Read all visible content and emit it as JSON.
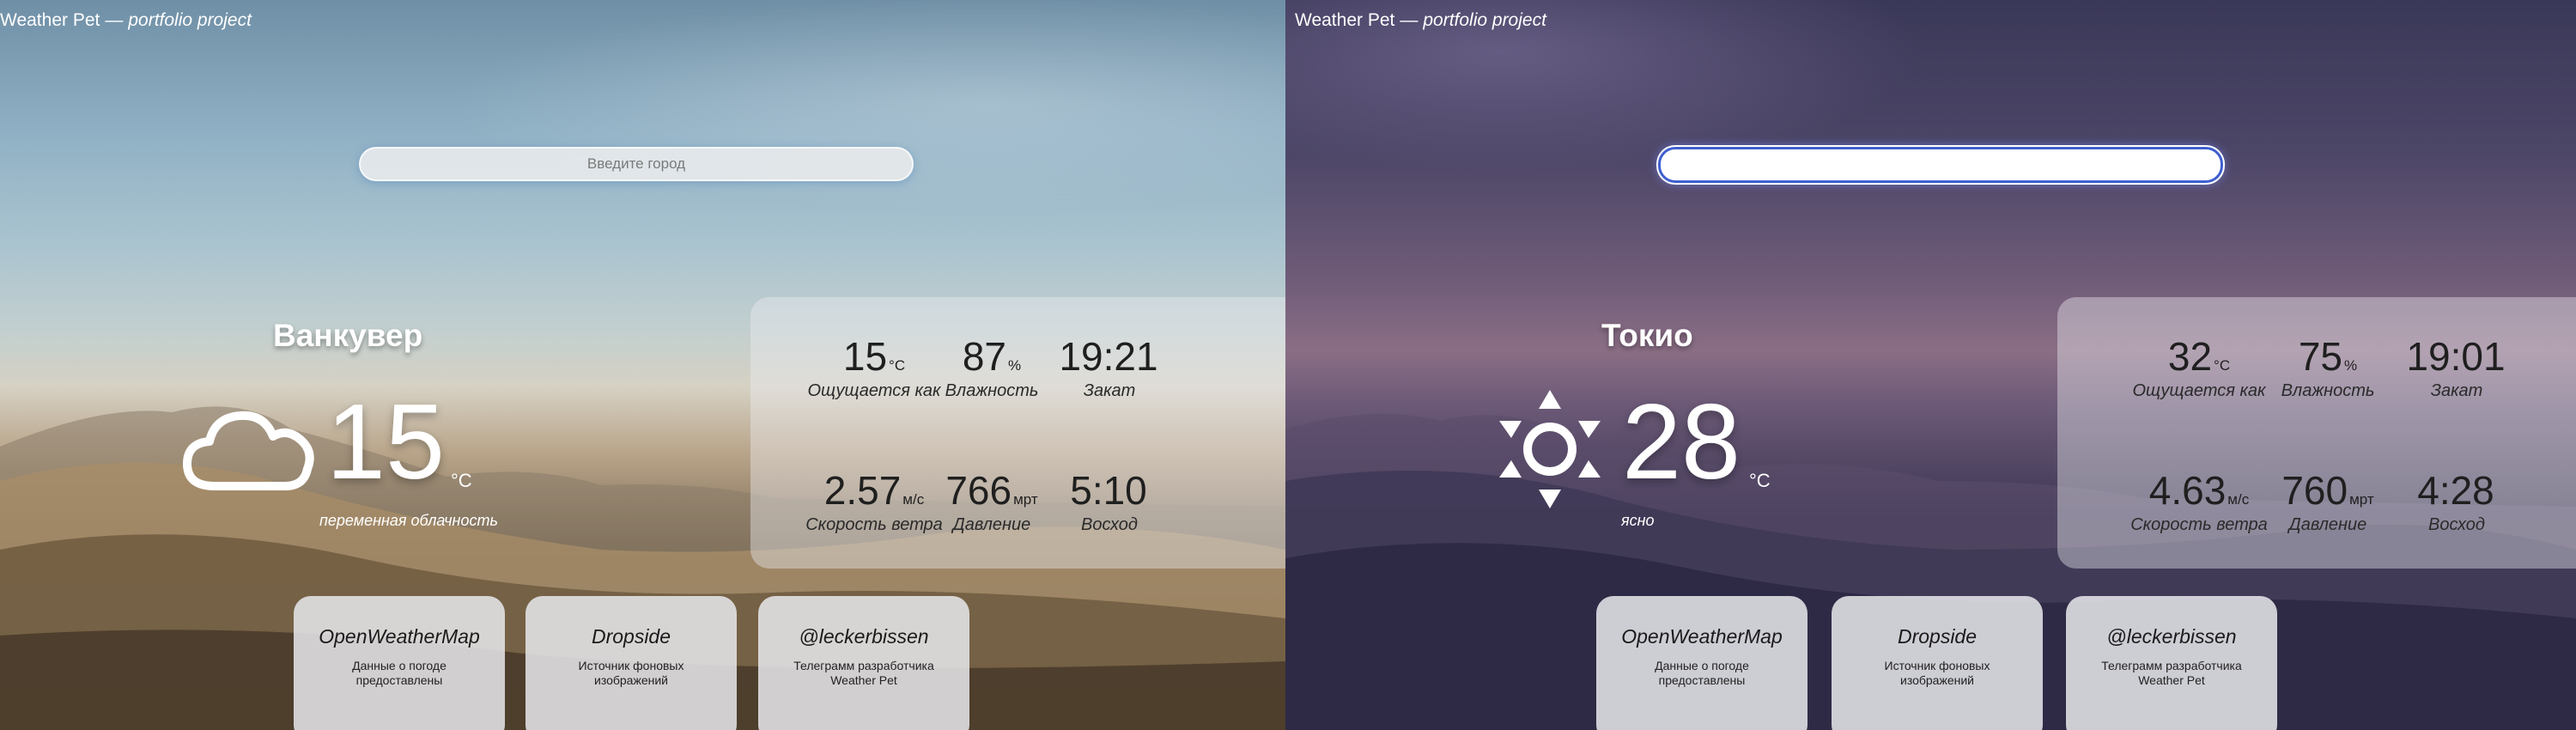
{
  "brand": {
    "title": "Weather Pet",
    "separator": "—",
    "subtitle": "portfolio project"
  },
  "left": {
    "search": {
      "placeholder": "Введите город",
      "value": ""
    },
    "city": "Ванкувер",
    "temperature": "15",
    "temp_unit": "°C",
    "icon": "cloud-icon",
    "description": "переменная облачность",
    "stats": [
      {
        "value": "15",
        "unit": "°C",
        "label": "Ощущается как"
      },
      {
        "value": "87",
        "unit": "%",
        "label": "Влажность"
      },
      {
        "value": "19:21",
        "unit": "",
        "label": "Закат"
      },
      {
        "value": "2.57",
        "unit": "м/с",
        "label": "Скорость ветра"
      },
      {
        "value": "766",
        "unit": "мрт",
        "label": "Давление"
      },
      {
        "value": "5:10",
        "unit": "",
        "label": "Восход"
      }
    ]
  },
  "right": {
    "search": {
      "placeholder": "",
      "value": ""
    },
    "city": "Токио",
    "temperature": "28",
    "temp_unit": "°C",
    "icon": "sun-icon",
    "description": "ясно",
    "stats": [
      {
        "value": "32",
        "unit": "°C",
        "label": "Ощущается как"
      },
      {
        "value": "75",
        "unit": "%",
        "label": "Влажность"
      },
      {
        "value": "19:01",
        "unit": "",
        "label": "Закат"
      },
      {
        "value": "4.63",
        "unit": "м/с",
        "label": "Скорость ветра"
      },
      {
        "value": "760",
        "unit": "мрт",
        "label": "Давление"
      },
      {
        "value": "4:28",
        "unit": "",
        "label": "Восход"
      }
    ]
  },
  "credits": [
    {
      "title": "OpenWeatherMap",
      "desc": "Данные о погоде предоставлены"
    },
    {
      "title": "Dropside",
      "desc": "Источник фоновых изображений"
    },
    {
      "title": "@leckerbissen",
      "desc": "Телеграмм разработчика Weather Pet"
    }
  ],
  "colors": {
    "focus_ring": "#3f5fcf",
    "text": "#ffffff",
    "card_text": "#1f1f1f"
  }
}
